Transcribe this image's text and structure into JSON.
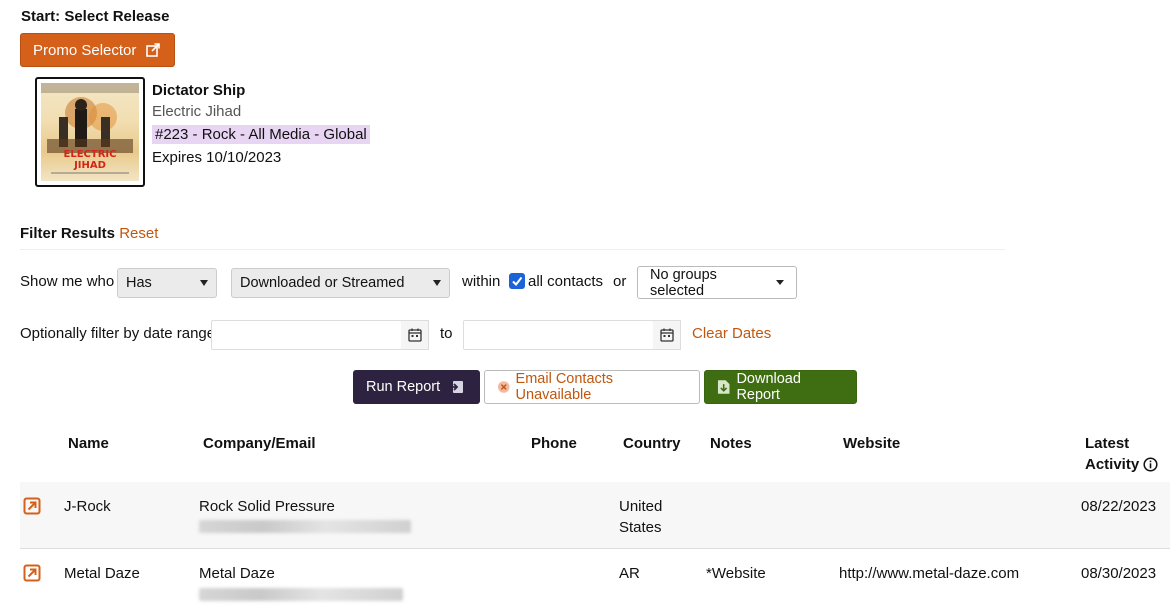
{
  "header": {
    "start_title": "Start: Select Release",
    "promo_label": "Promo Selector"
  },
  "release": {
    "title": "Dictator Ship",
    "artist": "Electric Jihad",
    "tag": "#223 - Rock - All Media - Global",
    "expires": "Expires 10/10/2023",
    "cover_text": "ELECTRIC JIHAD"
  },
  "filter": {
    "title": "Filter Results",
    "reset_label": "Reset",
    "show_me_who": "Show me who",
    "has_value": "Has",
    "action_value": "Downloaded or Streamed",
    "within": "within",
    "all_contacts": "all contacts",
    "or": "or",
    "groups_value": "No groups selected",
    "date_range_label": "Optionally filter by date range",
    "to": "to",
    "clear_dates": "Clear Dates"
  },
  "actions": {
    "run_report": "Run Report",
    "email_contacts": "Email Contacts Unavailable",
    "download_report": "Download Report"
  },
  "table": {
    "columns": [
      "Name",
      "Company/Email",
      "Phone",
      "Country",
      "Notes",
      "Website",
      "Latest",
      "Activity"
    ],
    "rows": [
      {
        "name": "J-Rock",
        "company": "Rock Solid Pressure",
        "country_line1": "United",
        "country_line2": "States",
        "notes": "",
        "website": "",
        "activity": "08/22/2023"
      },
      {
        "name": "Metal Daze",
        "company": "Metal Daze",
        "country_line1": "AR",
        "country_line2": "",
        "notes": "*Website",
        "website": "http://www.metal-daze.com",
        "activity": "08/30/2023"
      }
    ]
  },
  "colors": {
    "accent_orange": "#d4601a",
    "link_orange": "#c0570f",
    "run_button": "#2d2240",
    "download_button": "#3f6d12",
    "tag_background": "#e8d5f3",
    "checkbox": "#1a64d8"
  }
}
